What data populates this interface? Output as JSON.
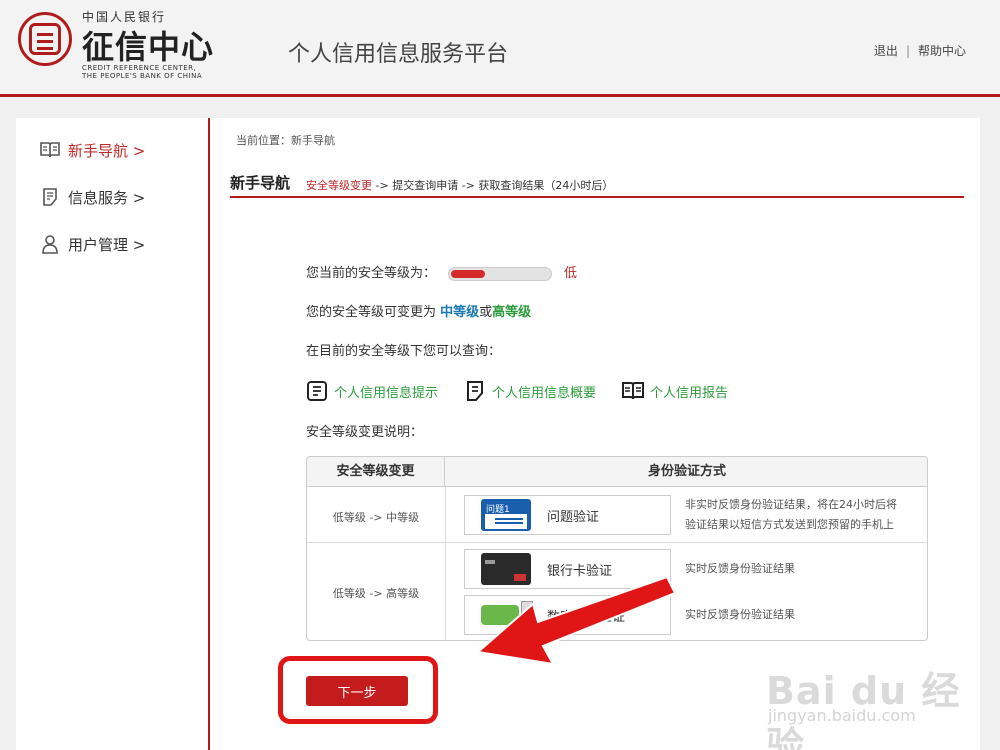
{
  "header": {
    "logo_top": "中国人民银行",
    "logo_main": "征信中心",
    "logo_en_line1": "CREDIT REFERENCE CENTER,",
    "logo_en_line2": "THE PEOPLE'S BANK OF CHINA",
    "platform_title": "个人信用信息服务平台",
    "logout": "退出",
    "separator": "|",
    "help": "帮助中心"
  },
  "sidebar": {
    "items": [
      {
        "label": "新手导航 >",
        "icon": "book-icon"
      },
      {
        "label": "信息服务 >",
        "icon": "document-icon"
      },
      {
        "label": "用户管理 >",
        "icon": "user-icon"
      }
    ]
  },
  "main": {
    "breadcrumb": "当前位置：新手导航",
    "section_title": "新手导航",
    "step_current": "安全等级变更",
    "step_rest": " -> 提交查询申请 -> 获取查询结果（24小时后）",
    "current_level_label": "您当前的安全等级为：",
    "current_level_value": "低",
    "current_level_fraction": 0.33,
    "change_prefix": "您的安全等级可变更为 ",
    "change_medium": "中等级",
    "change_or": "或",
    "change_high": "高等级",
    "query_label": "在目前的安全等级下您可以查询：",
    "services": [
      {
        "label": "个人信用信息提示",
        "icon": "document-lines-icon"
      },
      {
        "label": "个人信用信息概要",
        "icon": "document-corner-icon"
      },
      {
        "label": "个人信用报告",
        "icon": "book-icon"
      }
    ],
    "explain_label": "安全等级变更说明：",
    "table": {
      "header_col1": "安全等级变更",
      "header_col2": "身份验证方式",
      "row1_level": "低等级 -> 中等级",
      "row2_level": "低等级 -> 高等级",
      "methods": [
        {
          "label": "问题验证",
          "thumb_text": "问题1",
          "desc_line1": "非实时反馈身份验证结果，将在24小时后将",
          "desc_line2": "验证结果以短信方式发送到您预留的手机上"
        },
        {
          "label": "银行卡验证",
          "desc_line1": "实时反馈身份验证结果"
        },
        {
          "label": "数字证书验证",
          "desc_line1": "实时反馈身份验证结果"
        }
      ]
    },
    "next_button": "下一步"
  },
  "watermark": {
    "main": "Bai du 经验",
    "sub": "jingyan.baidu.com"
  },
  "colors": {
    "brand_red": "#b51a1a",
    "accent_green": "#2a9c3b",
    "accent_blue": "#1a78b4",
    "annotation_red": "#e01515"
  }
}
